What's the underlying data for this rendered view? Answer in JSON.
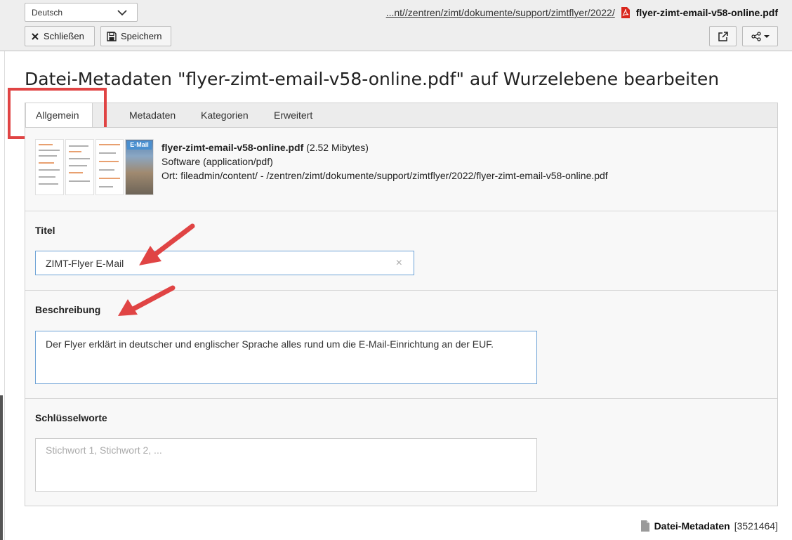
{
  "header": {
    "language": "Deutsch",
    "close_label": "Schließen",
    "save_label": "Speichern",
    "breadcrumb_path": "...nt//zentren/zimt/dokumente/support/zimtflyer/2022/",
    "breadcrumb_file": "flyer-zimt-email-v58-online.pdf",
    "icons": [
      "close-icon",
      "save-icon",
      "external-link-icon",
      "share-icon",
      "pdf-icon"
    ]
  },
  "page": {
    "title": "Datei-Metadaten \"flyer-zimt-email-v58-online.pdf\" auf Wurzelebene bearbeiten"
  },
  "tabs": [
    {
      "label": "Allgemein",
      "active": true
    },
    {
      "label": "Metadaten",
      "active": false
    },
    {
      "label": "Kategorien",
      "active": false
    },
    {
      "label": "Erweitert",
      "active": false
    }
  ],
  "file": {
    "name": "flyer-zimt-email-v58-online.pdf",
    "size": "(2.52 Mibytes)",
    "type": "Software (application/pdf)",
    "location": "Ort: fileadmin/content/ - /zentren/zimt/dokumente/support/zimtflyer/2022/flyer-zimt-email-v58-online.pdf",
    "thumb_tag": "E-Mail"
  },
  "fields": {
    "title_label": "Titel",
    "title_value": "ZIMT-Flyer E-Mail",
    "title_clear": "×",
    "description_label": "Beschreibung",
    "description_value": "Der Flyer erklärt in deutscher und englischer Sprache alles rund um die E-Mail-Einrichtung an der EUF.",
    "keywords_label": "Schlüsselworte",
    "keywords_placeholder": "Stichwort 1, Stichwort 2, ..."
  },
  "footer": {
    "record_label": "Datei-Metadaten",
    "record_id": "[3521464]"
  },
  "colors": {
    "highlight": "#e04444",
    "focus_border": "#6da2d6",
    "pdf_red": "#d9261c"
  }
}
